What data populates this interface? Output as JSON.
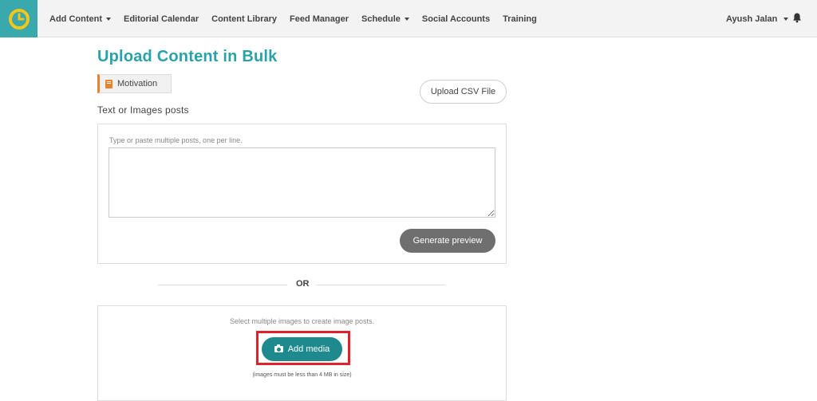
{
  "nav": {
    "items": [
      {
        "label": "Add Content",
        "dropdown": true
      },
      {
        "label": "Editorial Calendar",
        "dropdown": false
      },
      {
        "label": "Content Library",
        "dropdown": false
      },
      {
        "label": "Feed Manager",
        "dropdown": false
      },
      {
        "label": "Schedule",
        "dropdown": true
      },
      {
        "label": "Social Accounts",
        "dropdown": false
      },
      {
        "label": "Training",
        "dropdown": false
      }
    ],
    "user_name": "Ayush Jalan"
  },
  "page": {
    "title": "Upload Content in Bulk",
    "category_tag": "Motivation",
    "upload_csv_label": "Upload CSV File",
    "section_label": "Text or Images posts"
  },
  "text_panel": {
    "hint": "Type or paste multiple posts, one per line.",
    "textarea_value": "",
    "generate_label": "Generate preview"
  },
  "divider": {
    "label": "OR"
  },
  "media_panel": {
    "hint": "Select multiple images to create image posts.",
    "add_media_label": "Add media",
    "size_note": "(images must be less than 4 MB in size)"
  },
  "colors": {
    "brand": "#2aa3a8",
    "logo_bg": "#3aa9ad",
    "logo_yellow": "#f5c518",
    "tag_accent": "#e8832d",
    "add_media_bg": "#1e8a8e",
    "generate_bg": "#6f6f6f",
    "highlight": "#e0202a"
  },
  "icons": [
    "clock-logo-icon",
    "caret-down-icon",
    "bell-icon",
    "book-icon",
    "camera-icon"
  ]
}
